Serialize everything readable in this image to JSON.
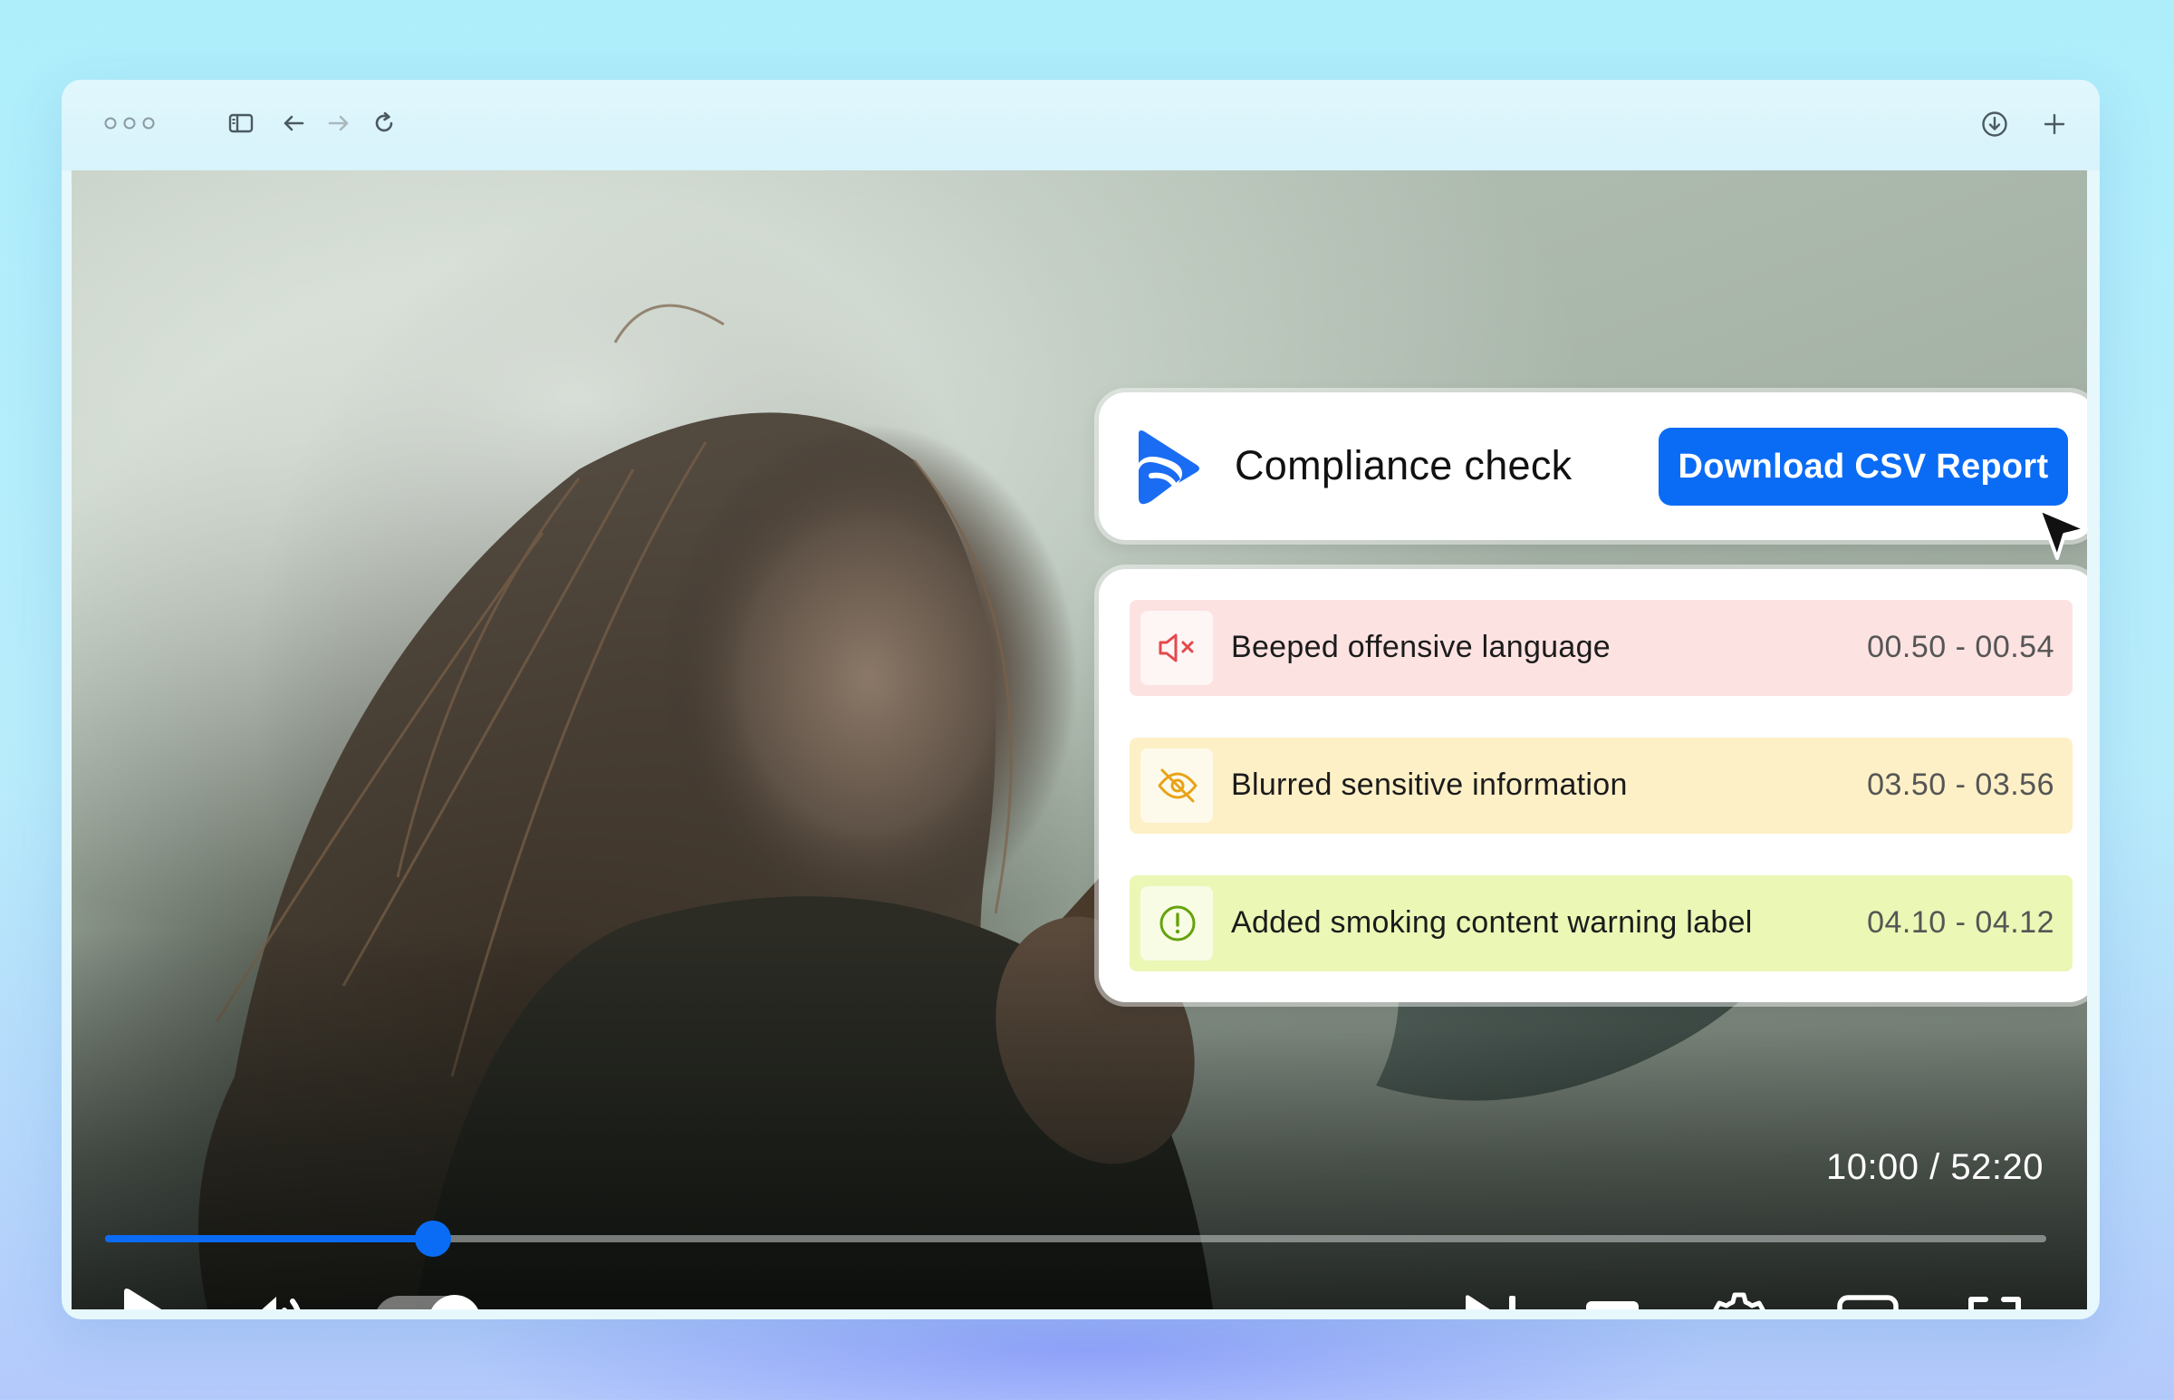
{
  "browser": {
    "window_controls": [
      "circle",
      "circle",
      "circle"
    ],
    "toolbar_icons": [
      "sidebar-icon",
      "back-arrow-icon",
      "forward-arrow-icon",
      "reload-icon",
      "download-icon",
      "new-tab-plus-icon"
    ]
  },
  "compliance": {
    "title": "Compliance check",
    "download_label": "Download CSV Report",
    "accent_color": "#0a6cf5",
    "events": [
      {
        "label": "Beeped offensive language",
        "time": "00.50 - 00.54",
        "icon": "muted-speaker-icon",
        "bg_color": "#fde2e2",
        "icon_color": "#e5484d"
      },
      {
        "label": "Blurred sensitive information",
        "time": "03.50 - 03.56",
        "icon": "eye-off-icon",
        "bg_color": "#fdf0c6",
        "icon_color": "#e8a317"
      },
      {
        "label": "Added smoking content warning label",
        "time": "04.10 - 04.12",
        "icon": "alert-circle-icon",
        "bg_color": "#eaf7b5",
        "icon_color": "#65a30d"
      }
    ]
  },
  "player": {
    "time_current": "10:00",
    "time_total": "52:20",
    "time_display": "10:00 / 52:20",
    "progress_fraction": 0.169,
    "autoplay_on": true,
    "controls": [
      "play-icon",
      "volume-icon",
      "autoplay-toggle",
      "skip-next-icon",
      "subtitles-icon",
      "settings-gear-icon",
      "miniplayer-icon",
      "fullscreen-icon"
    ]
  }
}
